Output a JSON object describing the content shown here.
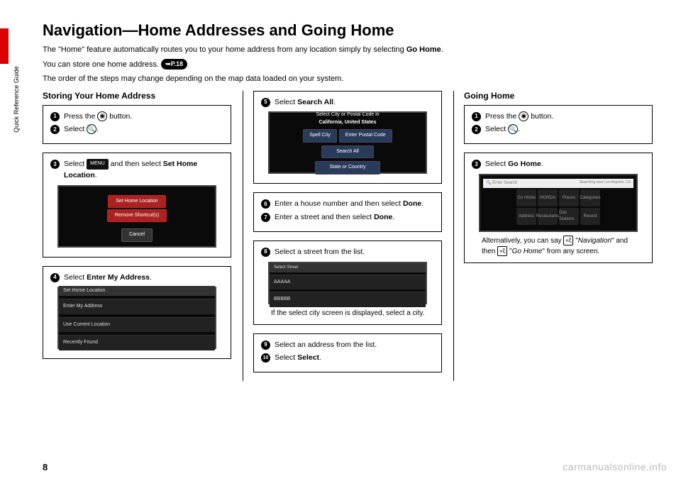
{
  "sideLabel": "Quick Reference Guide",
  "pageNumber": "8",
  "watermark": "carmanualsonline.info",
  "title": "Navigation—Home Addresses and Going Home",
  "intro": {
    "l1a": "The \"Home\" feature automatically routes you to your home address from any location simply by selecting ",
    "l1b": "Go Home",
    "l1c": ".",
    "l2a": "You can store one home address. ",
    "pill": "P.18",
    "l3": "The order of the steps may change depending on the map data loaded on your system."
  },
  "col1": {
    "heading": "Storing Your Home Address",
    "b1s1a": "Press the ",
    "b1s1b": " button.",
    "b1s2": "Select ",
    "b2s3a": "Select ",
    "b2s3b": " and then select ",
    "b2s3c": "Set Home Location",
    "b2s3d": ".",
    "menu": "MENU",
    "shotA": {
      "setHome": "Set Home Location",
      "remove": "Remove Shortcut(s)",
      "cancel": "Cancel"
    },
    "b3s4a": "Select ",
    "b3s4b": "Enter My Address",
    "b3s4c": ".",
    "shotB": {
      "hdr": "Set Home Location",
      "o1": "Enter My Address",
      "o2": "Use Current Location",
      "o3": "Recently Found"
    }
  },
  "col2": {
    "b1s5a": "Select ",
    "b1s5b": "Search All",
    "b1s5c": ".",
    "shotC": {
      "hdr1": "Select City or Postal Code in",
      "hdr2": "California, United States",
      "spell": "Spell City",
      "postal": "Enter Postal Code",
      "all": "Search All",
      "state": "State or Country"
    },
    "b2s6a": "Enter a house number and then select ",
    "b2s6b": "Done",
    "b2s6c": ".",
    "b2s7a": "Enter a street and then select ",
    "b2s7b": "Done",
    "b2s7c": ".",
    "b3s8": "Select a street from the list.",
    "shotD": {
      "hdr": "Select Street",
      "a": "AAAAA",
      "b": "BBBBB"
    },
    "b3note": "If the select city screen is displayed, select a city.",
    "b4s9": "Select an address from the list.",
    "b4s10a": "Select ",
    "b4s10b": "Select",
    "b4s10c": "."
  },
  "col3": {
    "heading": "Going Home",
    "b1s1a": "Press the ",
    "b1s1b": " button.",
    "b1s2": "Select ",
    "b2s3a": "Select ",
    "b2s3b": "Go Home",
    "b2s3c": ".",
    "shotE": {
      "search": "Enter Search",
      "near": "Searching near Los Angeles, CA",
      "g1": "Go Home",
      "g2": "HONDA",
      "g3": "Places",
      "g4": "Categories",
      "g5": "Address",
      "g6": "Restaurants",
      "g7": "Gas Stations",
      "g8": "Recent"
    },
    "alt1": "Alternatively, you can say ",
    "alt2": "\"",
    "alt2i": "Navigation",
    "alt3": "\" and then ",
    "alt4": " \"",
    "alt4i": "Go Home",
    "alt5": "\" from any screen."
  }
}
